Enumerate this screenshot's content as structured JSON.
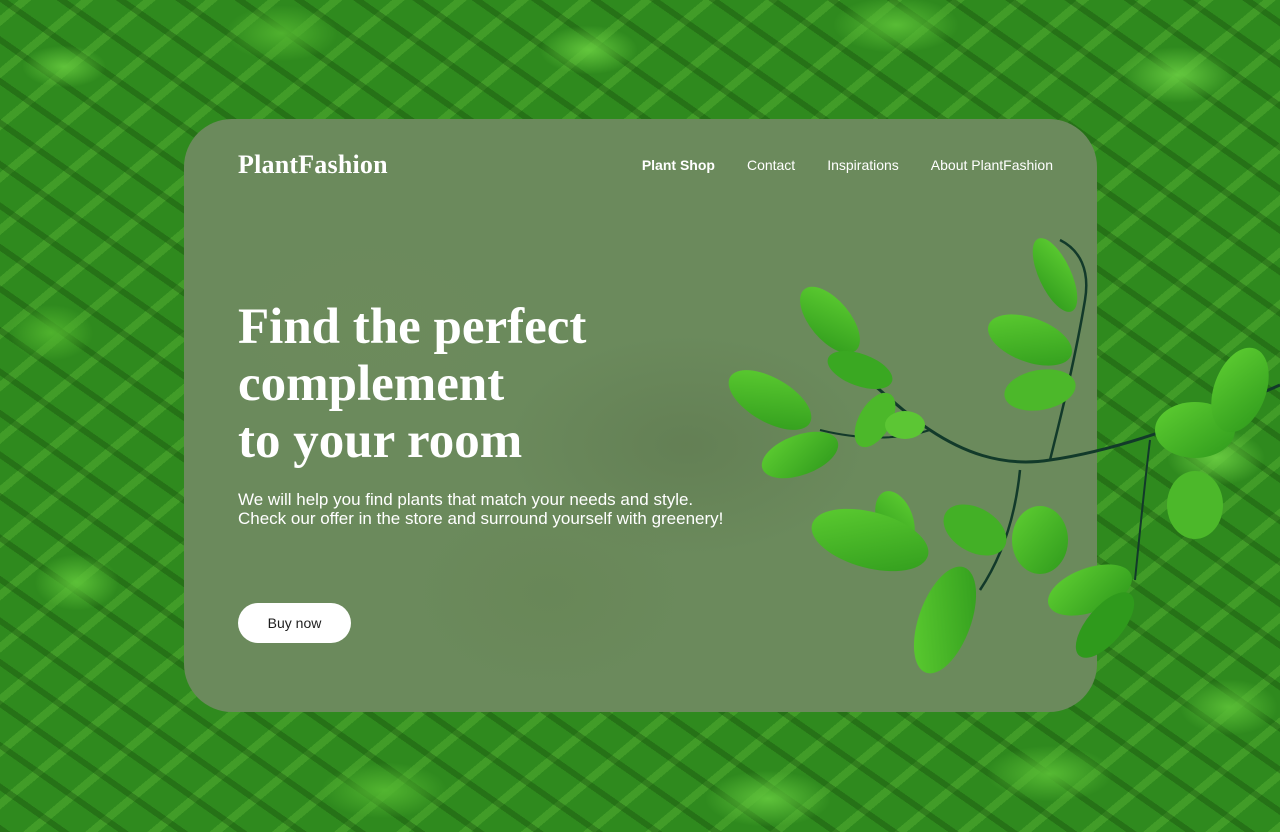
{
  "brand": {
    "name": "PlantFashion"
  },
  "nav": {
    "items": [
      {
        "label": "Plant Shop",
        "active": true
      },
      {
        "label": "Contact",
        "active": false
      },
      {
        "label": "Inspirations",
        "active": false
      },
      {
        "label": "About PlantFashion",
        "active": false
      }
    ]
  },
  "hero": {
    "headline_lines": [
      "Find the perfect",
      "complement",
      "to your room"
    ],
    "subtext_lines": [
      "We will help you find plants that match your needs and style.",
      "Check our offer in the store and surround yourself with greenery!"
    ],
    "cta_label": "Buy now"
  },
  "colors": {
    "leaf_background": "#2f8a1e",
    "card_overlay": "#6b8a5c",
    "leaf_green": "#4cb82a",
    "text": "#ffffff",
    "button_bg": "#ffffff",
    "button_text": "#1e1e1e"
  },
  "icons": {
    "decoration": "leaf-branch-icon"
  }
}
